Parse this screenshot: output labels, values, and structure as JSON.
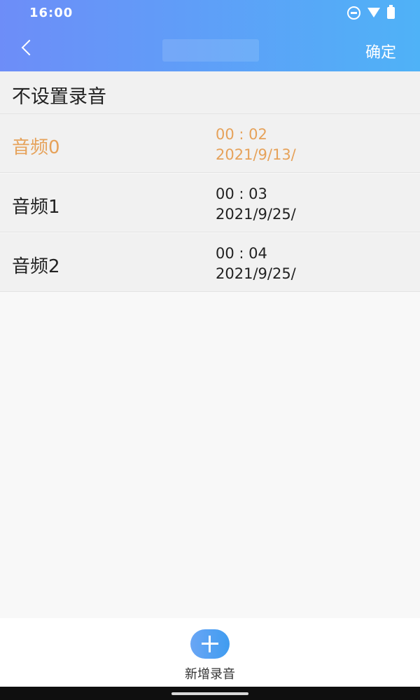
{
  "status_bar": {
    "time": "16:00",
    "icons": [
      "do-not-disturb-icon",
      "wifi-icon",
      "battery-icon"
    ]
  },
  "header": {
    "back_icon": "chevron-left-icon",
    "confirm_label": "确定"
  },
  "list": {
    "none_option": "不设置录音",
    "items": [
      {
        "name": "音频0",
        "duration": "00 : 02",
        "date": "2021/9/13/",
        "selected": true
      },
      {
        "name": "音频1",
        "duration": "00 : 03",
        "date": "2021/9/25/",
        "selected": false
      },
      {
        "name": "音频2",
        "duration": "00 : 04",
        "date": "2021/9/25/",
        "selected": false
      }
    ]
  },
  "footer": {
    "add_icon": "plus-icon",
    "add_label": "新增录音"
  },
  "colors": {
    "header_gradient_start": "#6d8df8",
    "header_gradient_end": "#4fb2f7",
    "selected_text": "#e6a25a",
    "add_button": "#4aa0f2"
  }
}
